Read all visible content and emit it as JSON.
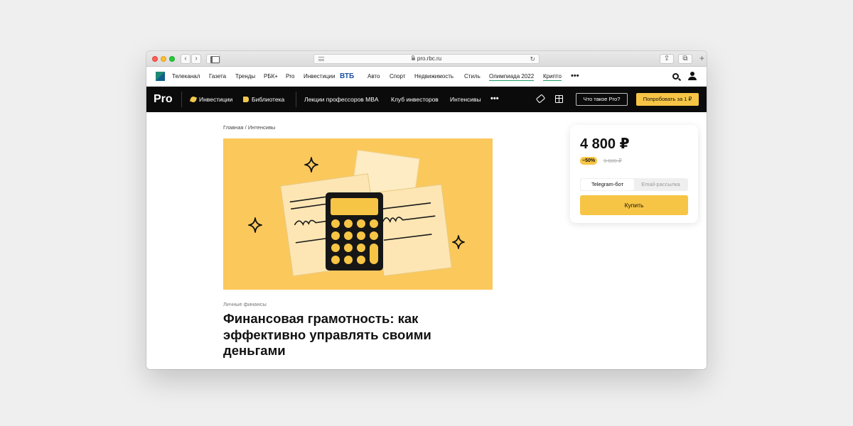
{
  "browser": {
    "url": "pro.rbc.ru",
    "back_icon": "chevron-left-icon",
    "forward_icon": "chevron-right-icon",
    "reload_icon": "reload-icon"
  },
  "topnav": {
    "items": [
      "Телеканал",
      "Газета",
      "Тренды",
      "РБК+",
      "Pro",
      "Инвестиции",
      "Авто",
      "Спорт",
      "Недвижимость",
      "Стиль",
      "Олимпиада 2022",
      "Крипто"
    ],
    "vtb_logo": "ВТБ",
    "more": "•••"
  },
  "probar": {
    "logo": "Pro",
    "invest": "Инвестиции",
    "library": "Библиотека",
    "mba": "Лекции профессоров MBA",
    "club": "Клуб инвесторов",
    "intensives": "Интенсивы",
    "more": "•••",
    "what_pro": "Что такое Pro?",
    "try": "Попробовать за 1 ₽"
  },
  "breadcrumb": {
    "home": "Главная",
    "sep": " / ",
    "section": "Интенсивы"
  },
  "article": {
    "category": "Личные финансы",
    "title": "Финансовая грамотность: как эффективно управлять своими деньгами",
    "hero_icon": "calculator-illustration"
  },
  "price_card": {
    "price": "4 800 ₽",
    "discount": "−50%",
    "old_price": "9 600 ₽",
    "option_active": "Telegram-бот",
    "option_inactive": "Email-рассылка",
    "buy": "Купить"
  },
  "colors": {
    "accent_yellow": "#f7c545",
    "hero_bg": "#fbc85c",
    "probar_bg": "#0b0b0b",
    "olympiad_underline": "#1f9e6a",
    "vtb_blue": "#1c4fa3"
  }
}
